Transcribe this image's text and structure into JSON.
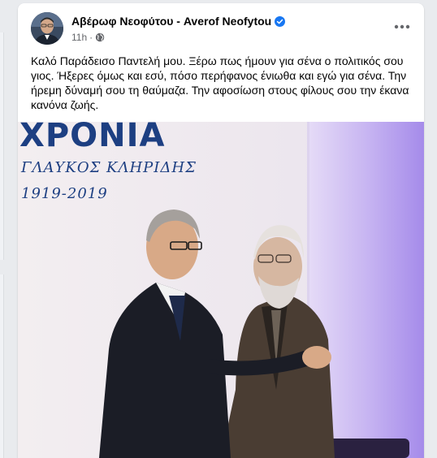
{
  "post": {
    "author": "Αβέρωφ Νεοφύτου - Averof Neofytou",
    "timestamp": "11h",
    "separator": "·",
    "text": "Καλό Παράδεισο Παντελή μου. Ξέρω πως ήμουν για σένα ο πολιτικός σου γιος. Ήξερες όμως και εσύ, πόσο περήφανος ένιωθα και εγώ για σένα. Την ήρεμη δύναμή σου τη θαύμαζα. Την αφοσίωση στους φίλους σου την έκανα κανόνα ζωής."
  },
  "photo": {
    "banner_title": "ΧΡΟΝΙΑ",
    "banner_name": "ΓΛΑΥΚΟΣ ΚΛΗΡΙΔΗΣ",
    "banner_years": "1919-2019"
  },
  "icons": {
    "verified": "verified-badge-icon",
    "privacy": "globe-icon",
    "more": "more-options-icon"
  },
  "colors": {
    "accent": "#1877f2",
    "text": "#050505",
    "secondary_text": "#65676b",
    "banner_blue": "#1d3f82"
  }
}
